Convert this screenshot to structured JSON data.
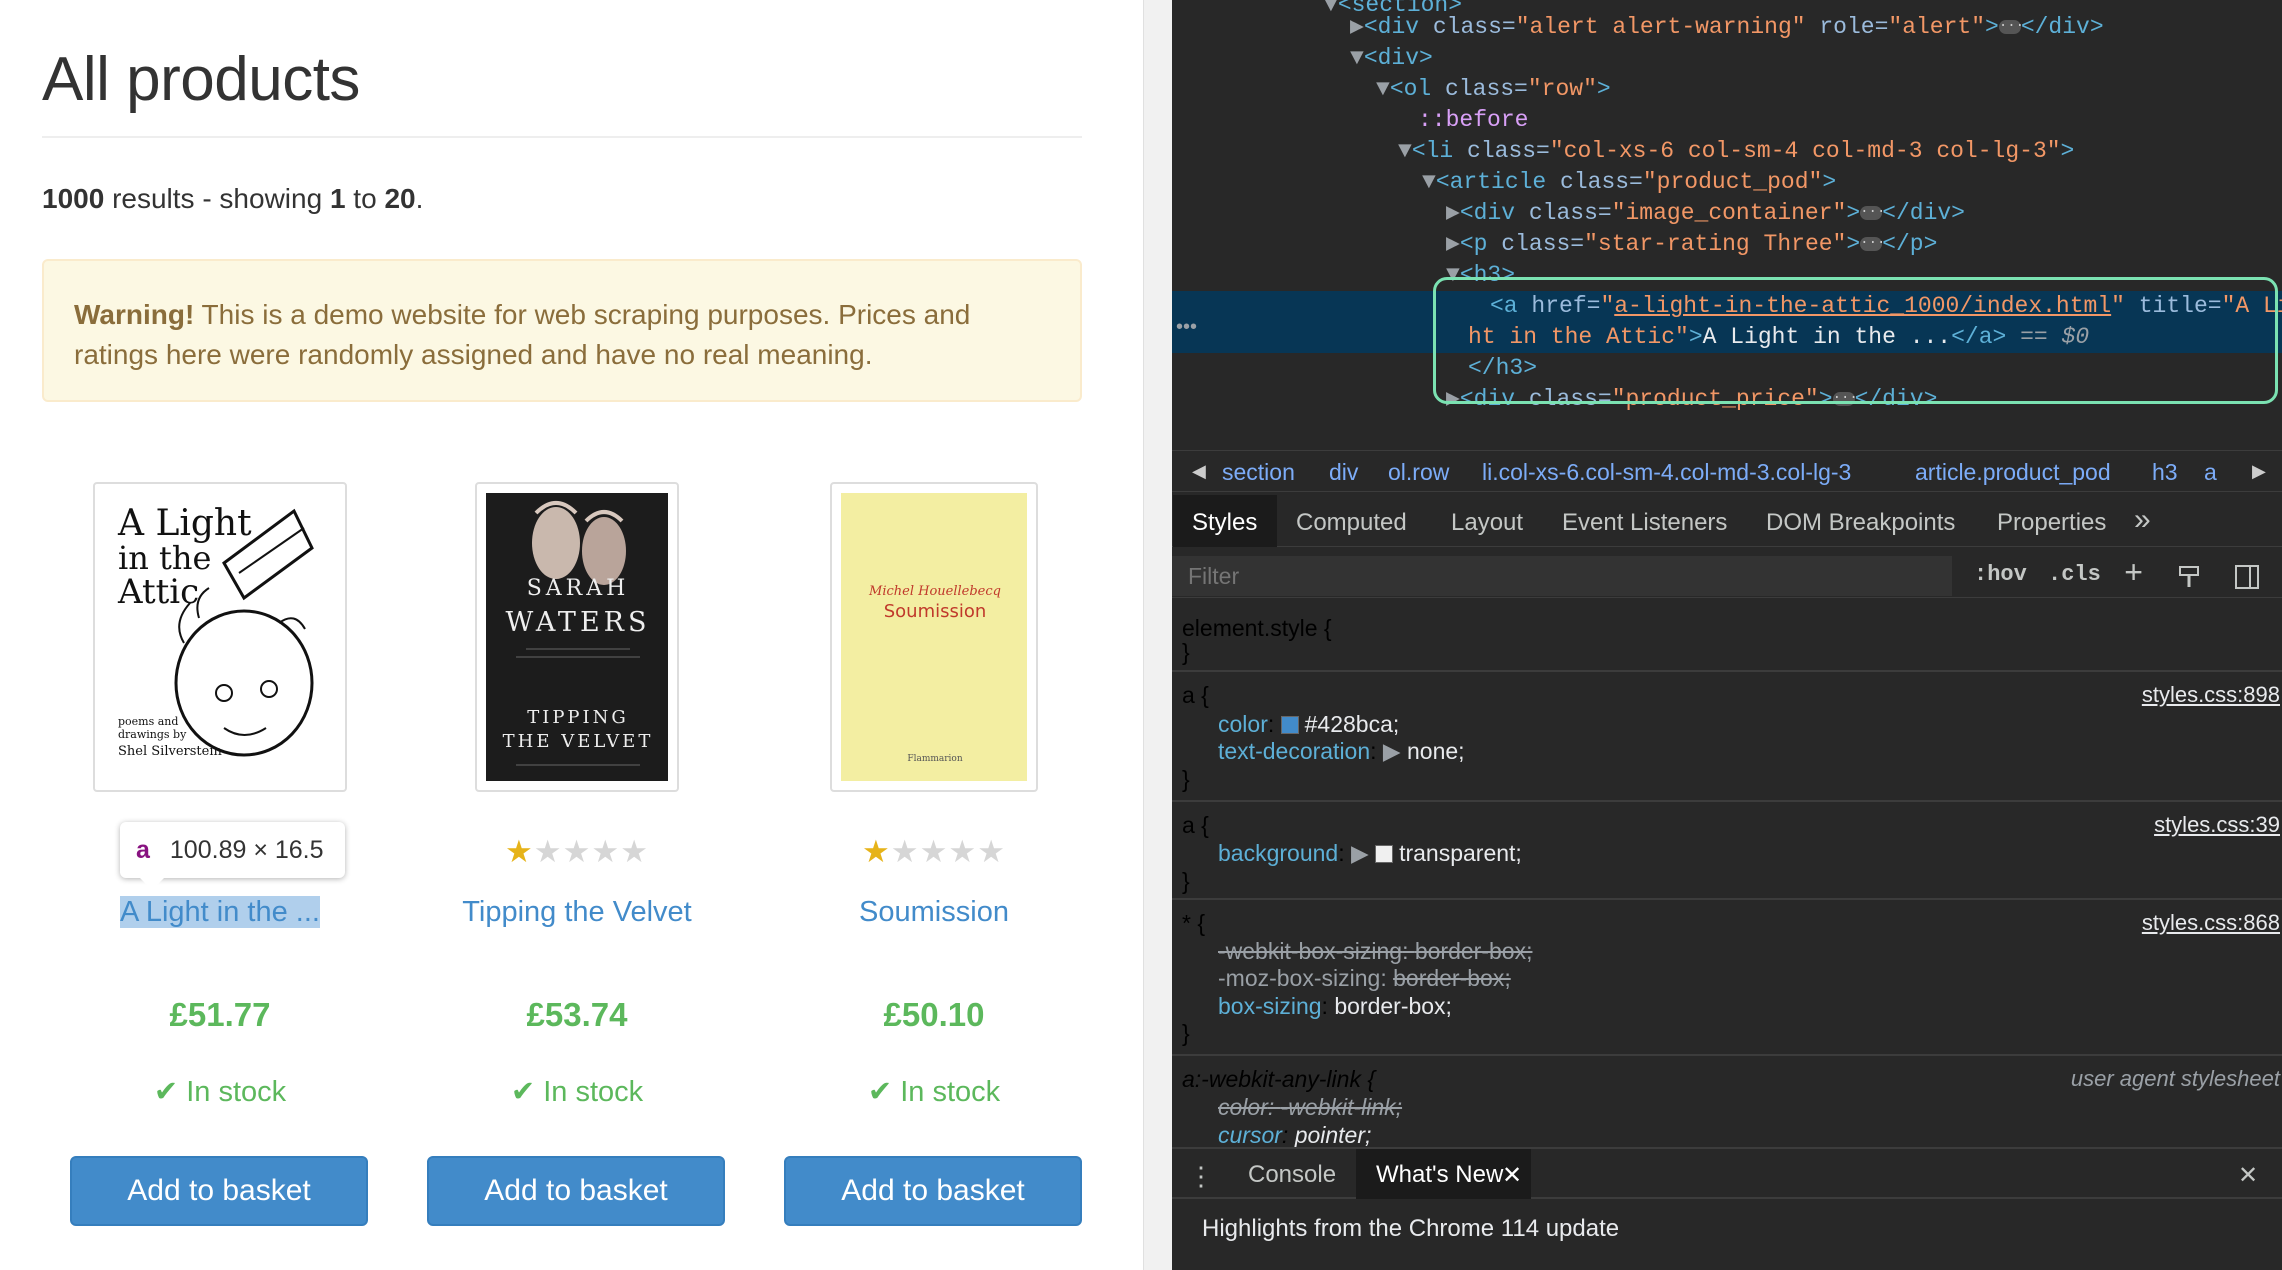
{
  "page": {
    "title": "All products",
    "results": {
      "count": "1000",
      "mid1": " results - showing ",
      "from": "1",
      "mid2": " to ",
      "to": "20",
      "end": "."
    },
    "alert": {
      "strong": "Warning!",
      "text": " This is a demo website for web scraping purposes. Prices and ratings here were randomly assigned and have no real meaning."
    },
    "inspect_tooltip": {
      "tag": "a",
      "size": "100.89 × 16.5"
    },
    "products": [
      {
        "title": "A Light in the ...",
        "price": "£51.77",
        "stock": "In stock",
        "button": "Add to basket",
        "rating": 3,
        "cover": {
          "line1": "A Light",
          "line2": "in the",
          "line3": "Attic",
          "credit1": "poems and",
          "credit2": "drawings by",
          "author": "Shel Silverstein"
        }
      },
      {
        "title": "Tipping the Velvet",
        "price": "£53.74",
        "stock": "In stock",
        "button": "Add to basket",
        "rating": 1,
        "cover": {
          "author1": "SARAH",
          "author2": "WATERS",
          "title1": "TIPPING",
          "title2": "THE VELVET"
        }
      },
      {
        "title": "Soumission",
        "price": "£50.10",
        "stock": "In stock",
        "button": "Add to basket",
        "rating": 1,
        "cover": {
          "author": "Michel Houellebecq",
          "title": "Soumission",
          "publisher": "Flammarion"
        }
      }
    ]
  },
  "devtools": {
    "dom": {
      "l0": "<section>",
      "l1_open": "<div ",
      "l1_attr": "class=",
      "l1_val": "\"alert alert-warning\"",
      "l1_attr2": " role=",
      "l1_val2": "\"alert\"",
      "l1_close": ">",
      "l1_end": "</div>",
      "l2": "<div>",
      "l3_open": "<ol ",
      "l3_attr": "class=",
      "l3_val": "\"row\"",
      "l3_close": ">",
      "l4": "::before",
      "l5_open": "<li ",
      "l5_attr": "class=",
      "l5_val": "\"col-xs-6 col-sm-4 col-md-3 col-lg-3\"",
      "l5_close": ">",
      "l6_open": "<article ",
      "l6_attr": "class=",
      "l6_val": "\"product_pod\"",
      "l6_close": ">",
      "l7_open": "<div ",
      "l7_attr": "class=",
      "l7_val": "\"image_container\"",
      "l7_close": ">",
      "l7_end": "</div>",
      "l8_open": "<p ",
      "l8_attr": "class=",
      "l8_val": "\"star-rating Three\"",
      "l8_close": ">",
      "l8_end": "</p>",
      "l9": "<h3>",
      "l10_open": "<a ",
      "l10_attr": "href=",
      "l10_q1": "\"",
      "l10_href": "a-light-in-the-attic_1000/index.html",
      "l10_q2": "\"",
      "l10_attr2": " title=",
      "l10_val2a": "\"A Lig",
      "l10b_val2b": "ht in the Attic\"",
      "l10b_close": ">",
      "l10b_text": "A Light in the ...",
      "l10b_end": "</a>",
      "l10b_eq": " == $0",
      "l11": "</h3>",
      "l12_open": "<div ",
      "l12_attr": "class=",
      "l12_val": "\"product_price\"",
      "l12_close": ">",
      "l12_end": "</div>",
      "dots": "•••"
    },
    "breadcrumb": [
      "section",
      "div",
      "ol.row",
      "li.col-xs-6.col-sm-4.col-md-3.col-lg-3",
      "article.product_pod",
      "h3",
      "a"
    ],
    "tabs": [
      "Styles",
      "Computed",
      "Layout",
      "Event Listeners",
      "DOM Breakpoints",
      "Properties"
    ],
    "tabs_more": "»",
    "filter_placeholder": "Filter",
    "filter_hov": ":hov",
    "filter_cls": ".cls",
    "rules": {
      "element_style": {
        "selector": "element.style {",
        "close": "}"
      },
      "a1": {
        "selector": "a {",
        "source": "styles.css:898",
        "color_name": "color",
        "color_val": "#428bca;",
        "color_hex": "#428bca",
        "td_name": "text-decoration",
        "td_val": "none;",
        "close": "}"
      },
      "a2": {
        "selector": "a {",
        "source": "styles.css:39",
        "bg_name": "background",
        "bg_val": "transparent;",
        "close": "}"
      },
      "star": {
        "selector": "* {",
        "source": "styles.css:868",
        "p1_name": "-webkit-box-sizing",
        "p1_val": "border-box;",
        "p2_name": "-moz-box-sizing",
        "p2_val": "border-box;",
        "p3_name": "box-sizing",
        "p3_val": "border-box;",
        "close": "}"
      },
      "ua": {
        "selector": "a:-webkit-any-link {",
        "source": "user agent stylesheet",
        "p1_name": "color",
        "p1_val": "-webkit-link;",
        "p2_name": "cursor",
        "p2_val": "pointer;"
      }
    },
    "drawer": {
      "console": "Console",
      "whats_new": "What's New",
      "highlights": "Highlights from the Chrome 114 update"
    }
  }
}
